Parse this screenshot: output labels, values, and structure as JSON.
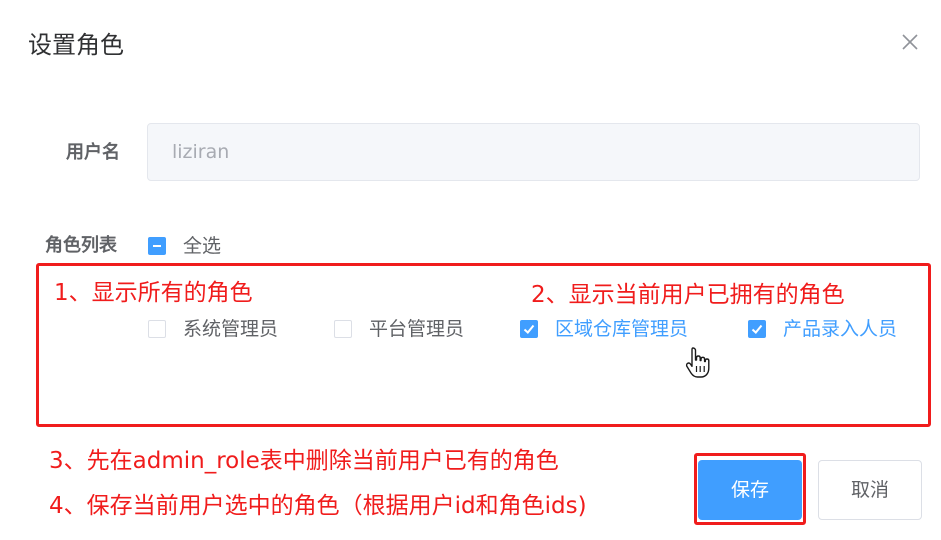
{
  "dialog": {
    "title": "设置角色",
    "close_icon": "close-icon"
  },
  "form": {
    "username_label": "用户名",
    "username_value": "liziran",
    "roles_label": "角色列表",
    "select_all": {
      "label": "全选",
      "state": "indeterminate"
    },
    "roles": [
      {
        "label": "系统管理员",
        "checked": false
      },
      {
        "label": "平台管理员",
        "checked": false
      },
      {
        "label": "区域仓库管理员",
        "checked": true
      },
      {
        "label": "产品录入人员",
        "checked": true
      }
    ]
  },
  "annotations": {
    "note1": "1、显示所有的角色",
    "note2": "2、显示当前用户已拥有的角色",
    "note3": "3、先在admin_role表中删除当前用户已有的角色",
    "note4": "4、保存当前用户选中的角色（根据用户id和角色ids)",
    "color": "#f01c1c"
  },
  "footer": {
    "save_label": "保存",
    "cancel_label": "取消"
  },
  "colors": {
    "primary": "#409eff",
    "text": "#606266",
    "title": "#303133",
    "placeholder": "#a8abb2",
    "input_bg": "#f5f7fa"
  }
}
